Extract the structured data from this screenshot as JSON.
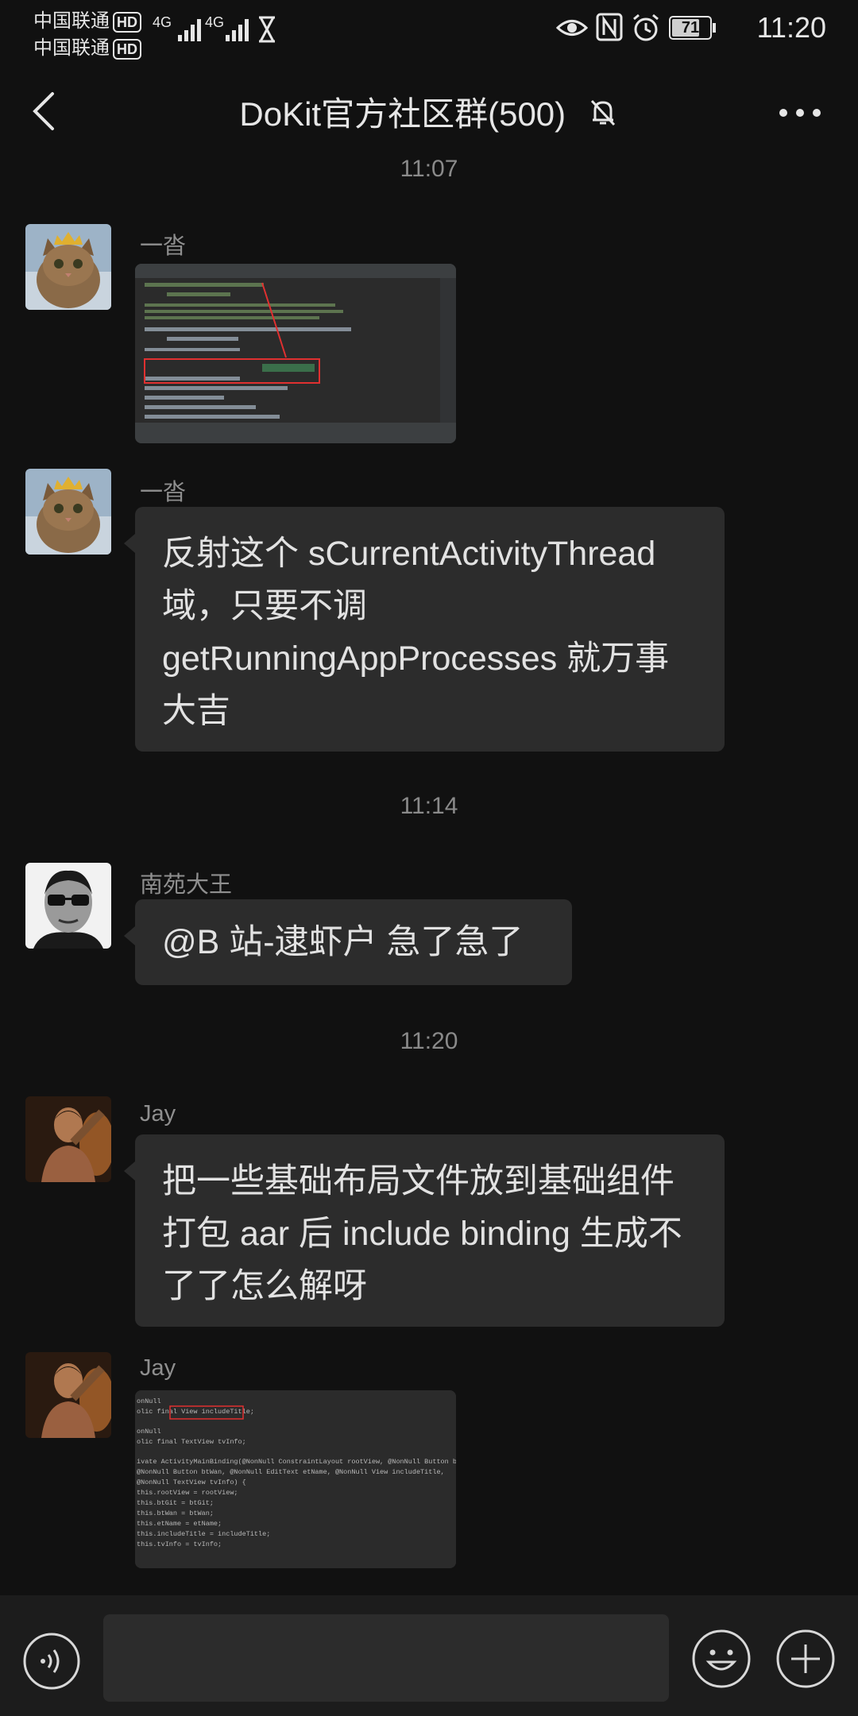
{
  "status_bar": {
    "carrier1": "中国联通",
    "carrier2": "中国联通",
    "hd": "HD",
    "network1": "4G",
    "network2": "4G",
    "battery": "71",
    "time": "11:20"
  },
  "header": {
    "title": "DoKit官方社区群(500)"
  },
  "messages": {
    "ts1": "11:07",
    "m1_sender": "一沓",
    "m2_sender": "一沓",
    "m2_text": "反射这个 sCurrentActivityThread 域，只要不调 getRunningAppProcesses 就万事大吉",
    "ts2": "11:14",
    "m3_sender": "南苑大王",
    "m3_text": "@B 站-逮虾户  急了急了",
    "ts3": "11:20",
    "m4_sender": "Jay",
    "m4_text": "把一些基础布局文件放到基础组件打包 aar 后 include binding 生成不了了怎么解呀",
    "m5_sender": "Jay"
  },
  "code_shot": {
    "lines": [
      "onNull",
      "olic final View includeTitle;",
      "onNull",
      "olic final TextView tvInfo;",
      "ivate ActivityMainBinding(@NonNull ConstraintLayout rootView, @NonNull Button btGit",
      "  @NonNull Button btWan, @NonNull EditText etName, @NonNull View includeTitle,",
      "  @NonNull TextView tvInfo) {",
      "this.rootView = rootView;",
      "this.btGit = btGit;",
      "this.btWan = btWan;",
      "this.etName = etName;",
      "this.includeTitle = includeTitle;",
      "this.tvInfo = tvInfo;"
    ]
  },
  "colors": {
    "background": "#111111",
    "bubble": "#2c2c2c",
    "bottom_bar": "#1c1c1c"
  }
}
